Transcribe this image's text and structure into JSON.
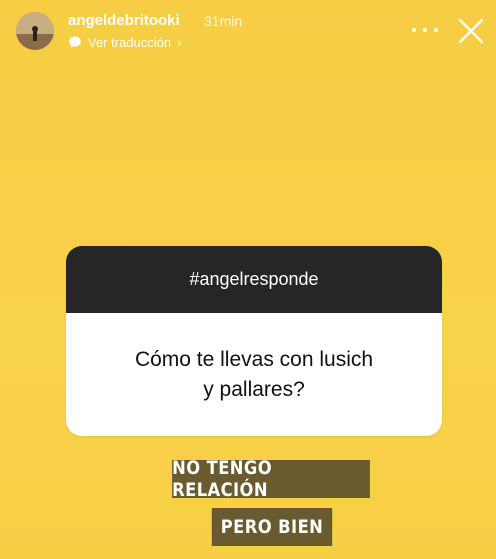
{
  "header": {
    "username": "angeldebritooki",
    "time": "31min",
    "translate_label": "Ver traducción",
    "translate_chevron": "›"
  },
  "sticker": {
    "hashtag": "#angelresponde",
    "question_line1": "Cómo te llevas con lusich",
    "question_line2": "y pallares?"
  },
  "captions": {
    "line1": "NO TENGO RELACIÓN",
    "line2": "PERO BIEN"
  },
  "colors": {
    "background": "#f6cd43",
    "sticker_header": "#262626",
    "caption_box": "#6a5a2f"
  },
  "icons": {
    "more": "more-options-icon",
    "close": "close-icon",
    "translate": "speech-bubble-icon"
  }
}
